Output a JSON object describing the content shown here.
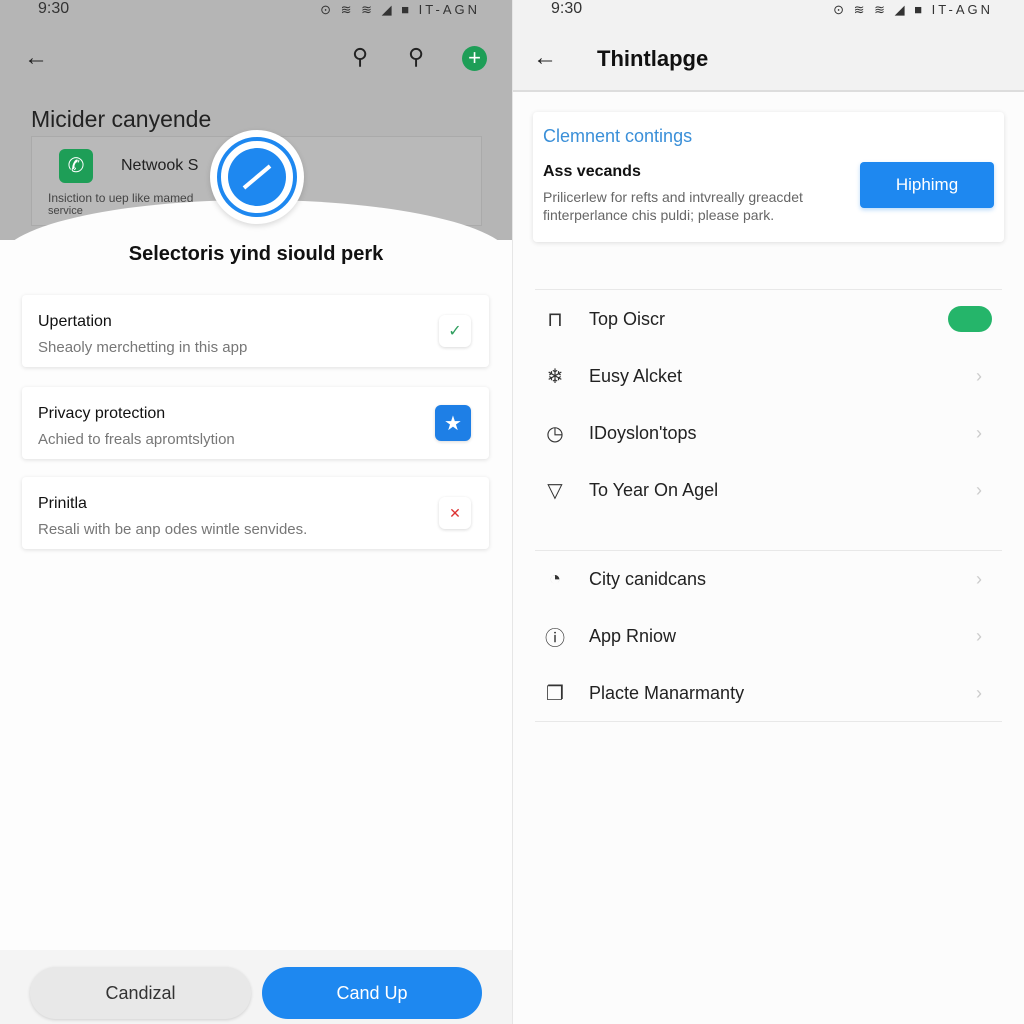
{
  "left": {
    "status": {
      "time": "9:30",
      "icons": "⊙ ≋ ≋ ◢ ■ IT-AGN"
    },
    "toolbar": {
      "back": "←",
      "search1": "⚲",
      "search2": "⚲",
      "add": "+"
    },
    "background_title": "Micider canyende",
    "background_card": {
      "title": "Netwook S",
      "text": "Insiction to uep like mamed",
      "text2": "service"
    },
    "dialog": {
      "title": "Selectoris yind siould perk",
      "items": [
        {
          "title": "Upertation",
          "subtitle": "Sheaoly merchetting in this app",
          "icon": "check-icon",
          "glyph": "✓",
          "color": "#2e9e5e"
        },
        {
          "title": "Privacy protection",
          "subtitle": "Achied to freals apromtslytion",
          "icon": "star-icon",
          "glyph": "★",
          "color": "#1e7fe6"
        },
        {
          "title": "Prinitla",
          "subtitle": "Resali with be anp odes wintle senvides.",
          "icon": "close-icon",
          "glyph": "✕",
          "color": "#d33"
        }
      ]
    },
    "buttons": {
      "secondary": "Candizal",
      "primary": "Cand Up"
    },
    "colors": {
      "accent": "#1e88f0",
      "green": "#1e9e57"
    }
  },
  "right": {
    "status": {
      "time": "9:30",
      "icons": "⊙ ≋ ≋ ◢ ■ IT-AGN"
    },
    "header": {
      "back": "←",
      "title": "Thintlapge"
    },
    "card": {
      "title": "Clemnent contings",
      "heading": "Ass vecands",
      "text1": "Prilicerlew for refts and intvreally greacdet",
      "text2": "finterperlance chis puldi; please park.",
      "button": "Hiphimg"
    },
    "group1": [
      {
        "label": "Top Oiscr",
        "icon": "lock-icon",
        "glyph": "⊓",
        "toggle": true,
        "toggle_on": true
      },
      {
        "label": "Eusy Alcket",
        "icon": "network-icon",
        "glyph": "❄"
      },
      {
        "label": "IDoyslon'tops",
        "icon": "history-icon",
        "glyph": "◷"
      },
      {
        "label": "To Year On Agel",
        "icon": "bell-icon",
        "glyph": "▽"
      }
    ],
    "group2": [
      {
        "label": "City canidcans",
        "icon": "clock-icon",
        "glyph": "◔"
      },
      {
        "label": "App Rniow",
        "icon": "info-icon",
        "glyph": "ⓘ"
      },
      {
        "label": "Placte Manarmanty",
        "icon": "windows-icon",
        "glyph": "❐"
      }
    ],
    "chevron": "›",
    "colors": {
      "toggle": "#25b56a",
      "link": "#3a8fd8",
      "button": "#1e88f0"
    }
  }
}
